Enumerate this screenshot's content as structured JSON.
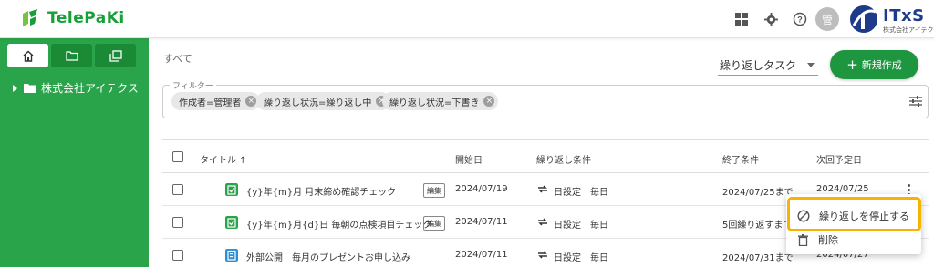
{
  "header": {
    "app_name": "TelePaKi",
    "avatar_text": "管",
    "brand_name": "ITxS",
    "brand_sub": "株式会社アイテクス"
  },
  "sidebar": {
    "tree_item": "株式会社アイテクス"
  },
  "main": {
    "breadcrumb": "すべて",
    "task_type_select": "繰り返しタスク",
    "new_button": "新規作成"
  },
  "filter": {
    "legend": "フィルター",
    "chips": [
      {
        "label": "作成者=管理者"
      },
      {
        "label": "繰り返し状況=繰り返し中"
      },
      {
        "label": "繰り返し状況=下書き"
      }
    ]
  },
  "table": {
    "headers": {
      "title": "タイトル ↑",
      "start": "開始日",
      "repeat": "繰り返し条件",
      "end": "終了条件",
      "next": "次回予定日"
    },
    "edit_label": "編集",
    "rows": [
      {
        "title": "{y}年{m}月 月末締め確認チェック",
        "start": "2024/07/19",
        "repeat": "日設定　毎日",
        "end": "2024/07/25まで",
        "next": "2024/07/25"
      },
      {
        "title": "{y}年{m}月{d}日 毎朝の点検項目チェック",
        "start": "2024/07/11",
        "repeat": "日設定　毎日",
        "end": "5回繰り返すまで",
        "next": ""
      },
      {
        "title": "外部公開　毎月のプレゼントお申し込み",
        "start": "2024/07/11",
        "repeat": "日設定　毎日",
        "end": "2024/07/31まで",
        "next": "2024/07/27"
      }
    ]
  },
  "context_menu": {
    "stop_repeat": "繰り返しを停止する",
    "delete": "削除"
  },
  "colors": {
    "brand_green": "#2aa44a",
    "button_green": "#1e9640",
    "highlight": "#f5b400"
  }
}
